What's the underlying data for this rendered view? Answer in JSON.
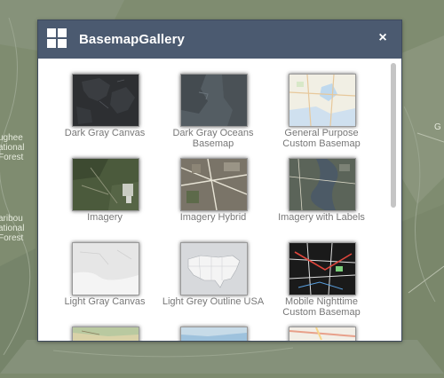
{
  "background_map": {
    "labels": [
      "ughee\national\nForest",
      "aribou\national\nForest",
      "G"
    ]
  },
  "dialog": {
    "title": "BasemapGallery",
    "close_label": "×"
  },
  "basemaps": [
    {
      "label": "Dark Gray Canvas",
      "thumbnail": "dark-gray-canvas"
    },
    {
      "label": "Dark Gray Oceans Basemap",
      "thumbnail": "dark-gray-oceans"
    },
    {
      "label": "General Purpose Custom Basemap",
      "thumbnail": "general-purpose"
    },
    {
      "label": "Imagery",
      "thumbnail": "imagery"
    },
    {
      "label": "Imagery Hybrid",
      "thumbnail": "imagery-hybrid"
    },
    {
      "label": "Imagery with Labels",
      "thumbnail": "imagery-labels"
    },
    {
      "label": "Light Gray Canvas",
      "thumbnail": "light-gray-canvas"
    },
    {
      "label": "Light Grey Outline USA",
      "thumbnail": "usa-outline"
    },
    {
      "label": "Mobile Nighttime Custom Basemap",
      "thumbnail": "mobile-nighttime"
    },
    {
      "label": "",
      "thumbnail": "national-geographic"
    },
    {
      "label": "",
      "thumbnail": "oceans"
    },
    {
      "label": "",
      "thumbnail": "openstreetmap"
    }
  ]
}
